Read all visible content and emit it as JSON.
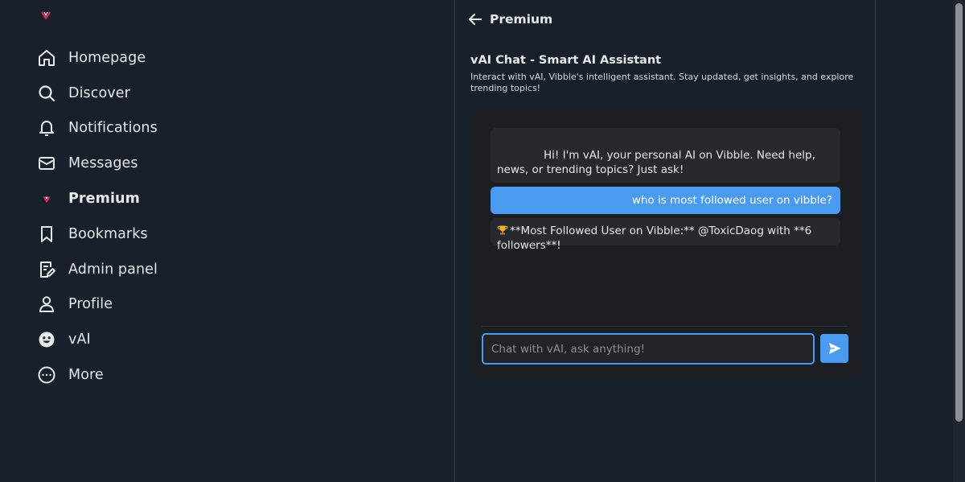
{
  "brand": {
    "logo_icon": "vibble-v-logo-icon",
    "accent": "#e0245e"
  },
  "sidebar": {
    "items": [
      {
        "label": "Homepage",
        "icon": "home-icon"
      },
      {
        "label": "Discover",
        "icon": "search-icon"
      },
      {
        "label": "Notifications",
        "icon": "bell-icon"
      },
      {
        "label": "Messages",
        "icon": "envelope-icon"
      },
      {
        "label": "Premium",
        "icon": "vibble-v-icon",
        "active": true
      },
      {
        "label": "Bookmarks",
        "icon": "bookmark-icon"
      },
      {
        "label": "Admin panel",
        "icon": "edit-document-icon"
      },
      {
        "label": "Profile",
        "icon": "person-icon"
      },
      {
        "label": "vAI",
        "icon": "ai-face-icon"
      },
      {
        "label": "More",
        "icon": "more-dots-icon"
      }
    ]
  },
  "header": {
    "title": "Premium",
    "back_icon": "arrow-left-icon"
  },
  "section": {
    "title": "vAI Chat - Smart AI Assistant",
    "description": "Interact with vAI, Vibble's intelligent assistant. Stay updated, get insights, and explore trending topics!"
  },
  "chat": {
    "messages": [
      {
        "role": "bot",
        "text": "Hi! I'm vAI, your personal AI on Vibble. Need help, news, or trending topics? Just ask!"
      },
      {
        "role": "user",
        "text": "who is most followed user on vibble?"
      },
      {
        "role": "bot",
        "icon": "trophy-icon",
        "text": "**Most Followed User on Vibble:** @ToxicDaog with **6 followers**!"
      }
    ],
    "input_placeholder": "Chat with vAI, ask anything!",
    "input_value": "",
    "send_icon": "send-icon",
    "user_bubble_color": "#4a9bf0"
  }
}
